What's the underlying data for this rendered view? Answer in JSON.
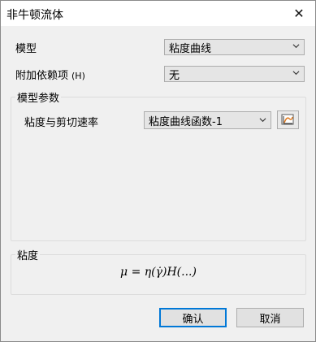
{
  "window": {
    "title": "非牛顿流体",
    "close_glyph": "✕"
  },
  "fields": {
    "model_label": "模型",
    "model_value": "粘度曲线",
    "attach_label": "附加依赖项",
    "attach_hint": "(H)",
    "attach_value": "无"
  },
  "params_group": {
    "title": "模型参数",
    "shear_label": "粘度与剪切速率",
    "shear_value": "粘度曲线函数-1",
    "edit_icon": "function-chart-icon"
  },
  "viscosity_group": {
    "title": "粘度",
    "formula": "μ = η(γ̇)H(...)"
  },
  "buttons": {
    "ok": "确认",
    "cancel": "取消"
  },
  "colors": {
    "default_button_border": "#0078d7",
    "dialog_bg": "#f0f0f0",
    "icon_accent": "#e07a1f"
  }
}
